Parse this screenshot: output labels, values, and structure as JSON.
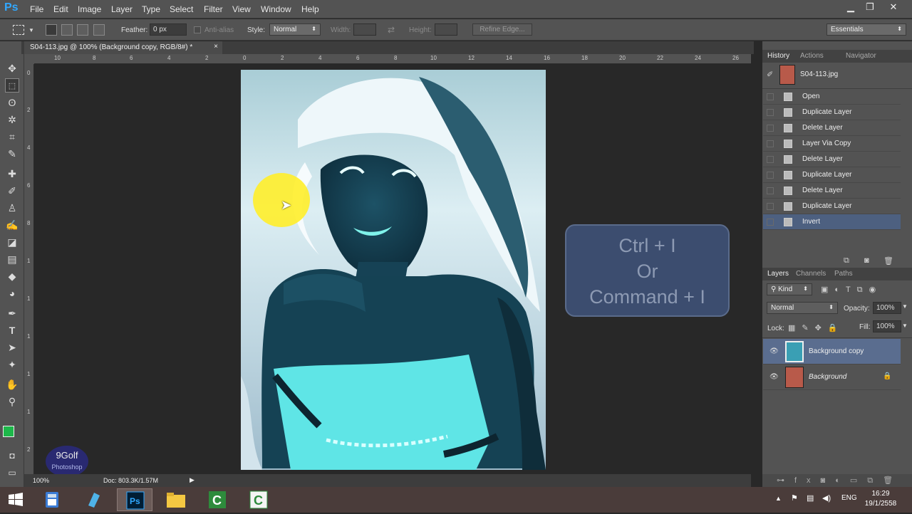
{
  "app": {
    "logo": "Ps",
    "accent": "#31a8ff"
  },
  "menu": [
    "File",
    "Edit",
    "Image",
    "Layer",
    "Type",
    "Select",
    "Filter",
    "View",
    "Window",
    "Help"
  ],
  "window_controls": {
    "minimize": "▁",
    "restore": "❐",
    "close": "✕"
  },
  "options": {
    "feather_label": "Feather:",
    "feather_value": "0 px",
    "antialias_label": "Anti-alias",
    "style_label": "Style:",
    "style_value": "Normal",
    "width_label": "Width:",
    "height_label": "Height:",
    "refine_edge": "Refine Edge...",
    "workspace": "Essentials"
  },
  "document": {
    "tab_title": "S04-113.jpg @ 100% (Background copy, RGB/8#) *",
    "close": "×",
    "ruler_h": [
      "10",
      "8",
      "6",
      "4",
      "2",
      "0",
      "2",
      "4",
      "6",
      "8",
      "10",
      "12",
      "14",
      "16",
      "18",
      "20",
      "22",
      "24",
      "26"
    ],
    "ruler_v": [
      "0",
      "2",
      "4",
      "6",
      "8",
      "1",
      "1",
      "1",
      "1",
      "1",
      "2",
      "2"
    ]
  },
  "status": {
    "zoom": "100%",
    "doc": "Doc: 803.3K/1.57M"
  },
  "history_panel": {
    "tabs": [
      "History",
      "Actions",
      "Navigator"
    ],
    "snapshot": "S04-113.jpg",
    "items": [
      "Open",
      "Duplicate Layer",
      "Delete Layer",
      "Layer Via Copy",
      "Delete Layer",
      "Duplicate Layer",
      "Delete Layer",
      "Duplicate Layer",
      "Invert"
    ],
    "selected_index": 8
  },
  "layers_panel": {
    "tabs": [
      "Layers",
      "Channels",
      "Paths"
    ],
    "kind": "Kind",
    "blend_mode": "Normal",
    "opacity_label": "Opacity:",
    "opacity_value": "100%",
    "lock_label": "Lock:",
    "fill_label": "Fill:",
    "fill_value": "100%",
    "layers": [
      {
        "name": "Background copy",
        "selected": true
      },
      {
        "name": "Background",
        "selected": false,
        "locked": true
      }
    ]
  },
  "overlay": {
    "line1": "Ctrl + I",
    "line2": "Or",
    "line3": "Command + I"
  },
  "watermark": {
    "line1": "9Golf",
    "line2": "Photoshop"
  },
  "taskbar": {
    "lang": "ENG",
    "time": "16:29",
    "date": "19/1/2558",
    "apps": [
      "windows",
      "calculator",
      "app-blue",
      "photoshop",
      "file-explorer",
      "camtasia-1",
      "camtasia-2"
    ]
  }
}
